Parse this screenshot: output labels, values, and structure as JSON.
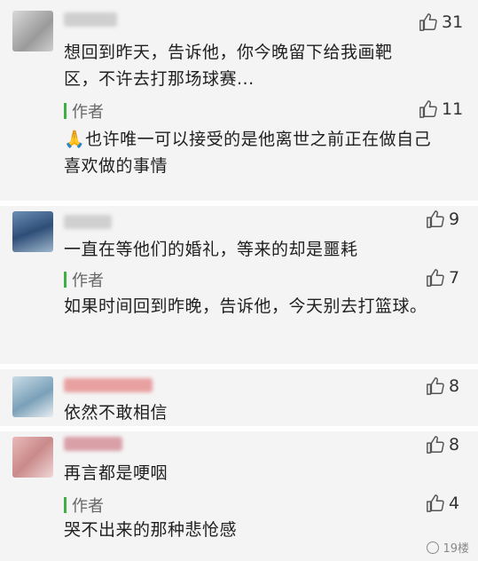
{
  "comments": [
    {
      "likes": "31",
      "text": "想回到昨天，告诉他，你今晚留下给我画靶区，不许去打那场球赛...",
      "reply": {
        "author_label": "作者",
        "likes": "11",
        "text": "🙏也许唯一可以接受的是他离世之前正在做自己喜欢做的事情"
      }
    },
    {
      "likes": "9",
      "text": "一直在等他们的婚礼，等来的却是噩耗",
      "reply": {
        "author_label": "作者",
        "likes": "7",
        "text": "如果时间回到昨晚，告诉他，今天别去打篮球。"
      }
    },
    {
      "likes": "8",
      "text": "依然不敢相信"
    },
    {
      "likes": "8",
      "text": "再言都是哽咽",
      "reply": {
        "author_label": "作者",
        "likes": "4",
        "text": "哭不出来的那种悲怆感"
      }
    }
  ],
  "footer": {
    "account": "19楼"
  },
  "icons": {
    "like": "thumbs-up-icon",
    "footer": "wechat-logo-icon"
  }
}
